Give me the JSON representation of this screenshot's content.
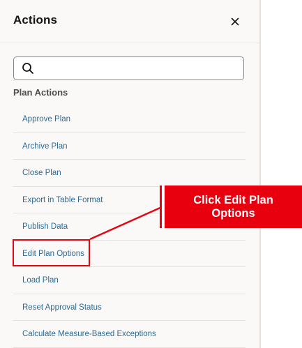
{
  "panel": {
    "title": "Actions",
    "close_icon": "close-icon"
  },
  "search": {
    "value": "",
    "placeholder": "",
    "icon": "search-icon"
  },
  "section": {
    "heading": "Plan Actions"
  },
  "actions": [
    {
      "label": "Approve Plan"
    },
    {
      "label": "Archive Plan"
    },
    {
      "label": "Close Plan"
    },
    {
      "label": "Export in Table Format"
    },
    {
      "label": "Publish Data"
    },
    {
      "label": "Edit Plan Options",
      "highlighted": true
    },
    {
      "label": "Load Plan"
    },
    {
      "label": "Reset Approval Status"
    },
    {
      "label": "Calculate Measure-Based Exceptions"
    }
  ],
  "callout": {
    "text": "Click Edit Plan Options",
    "color": "#e8000f",
    "points_to": "Edit Plan Options"
  },
  "colors": {
    "link": "#2b6a94",
    "panel_background": "#fbf9f8",
    "highlight": "#e30613"
  }
}
